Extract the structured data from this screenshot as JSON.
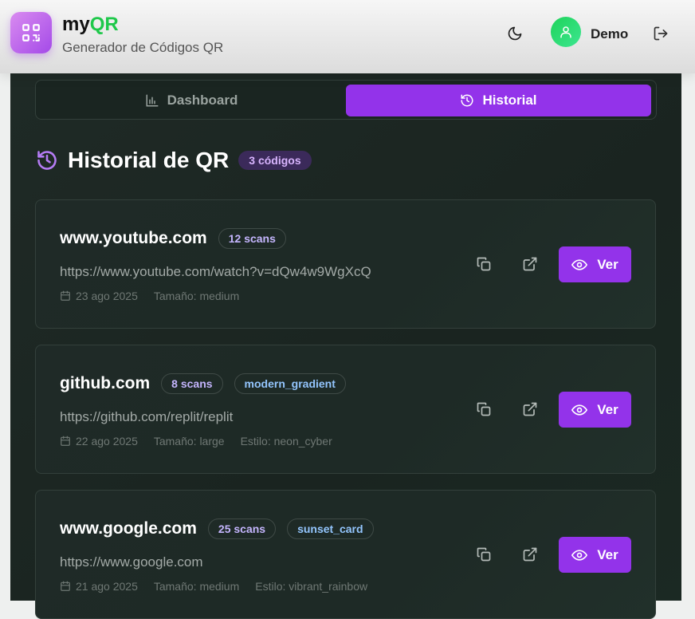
{
  "header": {
    "brand_prefix": "my",
    "brand_accent": "QR",
    "subtitle": "Generador de Códigos QR",
    "username": "Demo",
    "icons": [
      "qr-code-icon",
      "moon-icon",
      "user-icon",
      "logout-icon"
    ]
  },
  "tabs": {
    "dashboard": "Dashboard",
    "history": "Historial"
  },
  "section": {
    "title": "Historial de QR",
    "count": "3 códigos"
  },
  "cards": [
    {
      "title": "www.youtube.com",
      "scans": "12 scans",
      "style_badge": "",
      "url": "https://www.youtube.com/watch?v=dQw4w9WgXcQ",
      "date": "23 ago 2025",
      "size": "Tamaño: medium",
      "style": "",
      "view": "Ver"
    },
    {
      "title": "github.com",
      "scans": "8 scans",
      "style_badge": "modern_gradient",
      "url": "https://github.com/replit/replit",
      "date": "22 ago 2025",
      "size": "Tamaño: large",
      "style": "Estilo: neon_cyber",
      "view": "Ver"
    },
    {
      "title": "www.google.com",
      "scans": "25 scans",
      "style_badge": "sunset_card",
      "url": "https://www.google.com",
      "date": "21 ago 2025",
      "size": "Tamaño: medium",
      "style": "Estilo: vibrant_rainbow",
      "view": "Ver"
    }
  ],
  "colors": {
    "accent": "#9333ea",
    "brand_green": "#1ec84a",
    "panel_bg": "#1c2622"
  }
}
